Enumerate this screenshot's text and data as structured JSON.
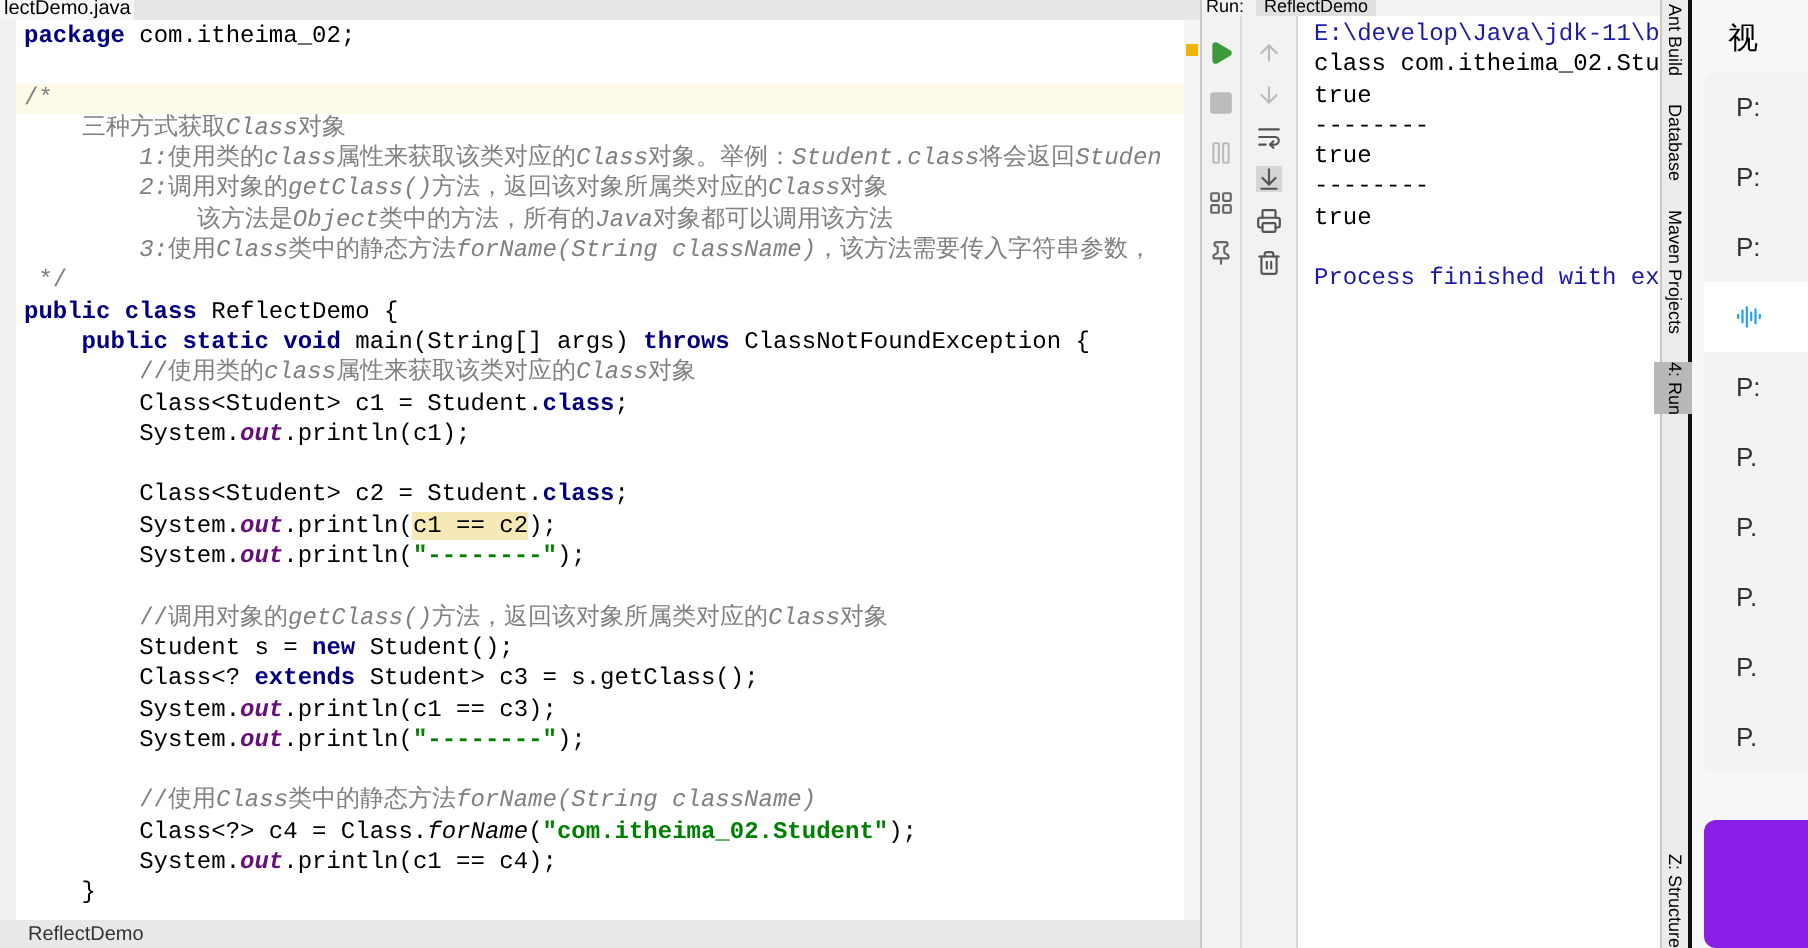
{
  "editor": {
    "tab": "lectDemo.java",
    "lines": [
      {
        "kind": "code",
        "current": false,
        "tokens": [
          {
            "text": "package",
            "kind": "kw"
          },
          {
            "text": " com.itheima_02;",
            "kind": "plain"
          }
        ]
      },
      {
        "kind": "blank"
      },
      {
        "kind": "code",
        "current": true,
        "tokens": [
          {
            "text": "/*",
            "kind": "cm"
          }
        ]
      },
      {
        "kind": "code",
        "current": false,
        "tokens": [
          {
            "text": "    三种方式获取",
            "kind": "cm"
          },
          {
            "text": "Class",
            "kind": "cmi"
          },
          {
            "text": "对象",
            "kind": "cm"
          }
        ]
      },
      {
        "kind": "code",
        "current": false,
        "tokens": [
          {
            "text": "        1:",
            "kind": "cmi"
          },
          {
            "text": "使用类的",
            "kind": "cm"
          },
          {
            "text": "class",
            "kind": "cmi"
          },
          {
            "text": "属性来获取该类对应的",
            "kind": "cm"
          },
          {
            "text": "Class",
            "kind": "cmi"
          },
          {
            "text": "对象。举例：",
            "kind": "cm"
          },
          {
            "text": "Student.class",
            "kind": "cmi"
          },
          {
            "text": "将会返回",
            "kind": "cm"
          },
          {
            "text": "Studen",
            "kind": "cmi"
          }
        ]
      },
      {
        "kind": "code",
        "current": false,
        "tokens": [
          {
            "text": "        2:",
            "kind": "cmi"
          },
          {
            "text": "调用对象的",
            "kind": "cm"
          },
          {
            "text": "getClass()",
            "kind": "cmi"
          },
          {
            "text": "方法，返回该对象所属类对应的",
            "kind": "cm"
          },
          {
            "text": "Class",
            "kind": "cmi"
          },
          {
            "text": "对象",
            "kind": "cm"
          }
        ]
      },
      {
        "kind": "code",
        "current": false,
        "tokens": [
          {
            "text": "            该方法是",
            "kind": "cm"
          },
          {
            "text": "Object",
            "kind": "cmi"
          },
          {
            "text": "类中的方法，所有的",
            "kind": "cm"
          },
          {
            "text": "Java",
            "kind": "cmi"
          },
          {
            "text": "对象都可以调用该方法",
            "kind": "cm"
          }
        ]
      },
      {
        "kind": "code",
        "current": false,
        "tokens": [
          {
            "text": "        3:",
            "kind": "cmi"
          },
          {
            "text": "使用",
            "kind": "cm"
          },
          {
            "text": "Class",
            "kind": "cmi"
          },
          {
            "text": "类中的静态方法",
            "kind": "cm"
          },
          {
            "text": "forName(String className)",
            "kind": "cmi"
          },
          {
            "text": "，该方法需要传入字符串参数，",
            "kind": "cm"
          }
        ]
      },
      {
        "kind": "code",
        "current": false,
        "tokens": [
          {
            "text": " */",
            "kind": "cm"
          }
        ]
      },
      {
        "kind": "code",
        "current": false,
        "tokens": [
          {
            "text": "public class",
            "kind": "kw"
          },
          {
            "text": " ReflectDemo {",
            "kind": "plain"
          }
        ]
      },
      {
        "kind": "code",
        "current": false,
        "tokens": [
          {
            "text": "    public static void",
            "kind": "kw"
          },
          {
            "text": " main(String[] args) ",
            "kind": "plain"
          },
          {
            "text": "throws",
            "kind": "kw"
          },
          {
            "text": " ClassNotFoundException {",
            "kind": "plain"
          }
        ]
      },
      {
        "kind": "code",
        "current": false,
        "tokens": [
          {
            "text": "        //使用类的",
            "kind": "cm"
          },
          {
            "text": "class",
            "kind": "cmi"
          },
          {
            "text": "属性来获取该类对应的",
            "kind": "cm"
          },
          {
            "text": "Class",
            "kind": "cmi"
          },
          {
            "text": "对象",
            "kind": "cm"
          }
        ]
      },
      {
        "kind": "code",
        "current": false,
        "tokens": [
          {
            "text": "        Class<Student> c1 = Student.",
            "kind": "plain"
          },
          {
            "text": "class",
            "kind": "kw"
          },
          {
            "text": ";",
            "kind": "plain"
          }
        ]
      },
      {
        "kind": "code",
        "current": false,
        "tokens": [
          {
            "text": "        System.",
            "kind": "plain"
          },
          {
            "text": "out",
            "kind": "field"
          },
          {
            "text": ".println(c1);",
            "kind": "plain"
          }
        ]
      },
      {
        "kind": "blank"
      },
      {
        "kind": "code",
        "current": false,
        "tokens": [
          {
            "text": "        Class<Student> c2 = Student.",
            "kind": "plain"
          },
          {
            "text": "class",
            "kind": "kw"
          },
          {
            "text": ";",
            "kind": "plain"
          }
        ]
      },
      {
        "kind": "code",
        "current": false,
        "tokens": [
          {
            "text": "        System.",
            "kind": "plain"
          },
          {
            "text": "out",
            "kind": "field"
          },
          {
            "text": ".println(",
            "kind": "plain"
          },
          {
            "text": "c1 == c2",
            "kind": "hl"
          },
          {
            "text": ");",
            "kind": "plain"
          }
        ]
      },
      {
        "kind": "code",
        "current": false,
        "tokens": [
          {
            "text": "        System.",
            "kind": "plain"
          },
          {
            "text": "out",
            "kind": "field"
          },
          {
            "text": ".println(",
            "kind": "plain"
          },
          {
            "text": "\"--------\"",
            "kind": "str"
          },
          {
            "text": ");",
            "kind": "plain"
          }
        ]
      },
      {
        "kind": "blank"
      },
      {
        "kind": "code",
        "current": false,
        "tokens": [
          {
            "text": "        //调用对象的",
            "kind": "cm"
          },
          {
            "text": "getClass()",
            "kind": "cmi"
          },
          {
            "text": "方法，返回该对象所属类对应的",
            "kind": "cm"
          },
          {
            "text": "Class",
            "kind": "cmi"
          },
          {
            "text": "对象",
            "kind": "cm"
          }
        ]
      },
      {
        "kind": "code",
        "current": false,
        "tokens": [
          {
            "text": "        Student s = ",
            "kind": "plain"
          },
          {
            "text": "new",
            "kind": "kw"
          },
          {
            "text": " Student();",
            "kind": "plain"
          }
        ]
      },
      {
        "kind": "code",
        "current": false,
        "tokens": [
          {
            "text": "        Class<? ",
            "kind": "plain"
          },
          {
            "text": "extends",
            "kind": "kw"
          },
          {
            "text": " Student> c3 = s.getClass();",
            "kind": "plain"
          }
        ]
      },
      {
        "kind": "code",
        "current": false,
        "tokens": [
          {
            "text": "        System.",
            "kind": "plain"
          },
          {
            "text": "out",
            "kind": "field"
          },
          {
            "text": ".println(c1 == c3);",
            "kind": "plain"
          }
        ]
      },
      {
        "kind": "code",
        "current": false,
        "tokens": [
          {
            "text": "        System.",
            "kind": "plain"
          },
          {
            "text": "out",
            "kind": "field"
          },
          {
            "text": ".println(",
            "kind": "plain"
          },
          {
            "text": "\"--------\"",
            "kind": "str"
          },
          {
            "text": ");",
            "kind": "plain"
          }
        ]
      },
      {
        "kind": "blank"
      },
      {
        "kind": "code",
        "current": false,
        "tokens": [
          {
            "text": "        //使用",
            "kind": "cm"
          },
          {
            "text": "Class",
            "kind": "cmi"
          },
          {
            "text": "类中的静态方法",
            "kind": "cm"
          },
          {
            "text": "forName(String className)",
            "kind": "cmi"
          }
        ]
      },
      {
        "kind": "code",
        "current": false,
        "tokens": [
          {
            "text": "        Class<?> c4 = Class.",
            "kind": "plain"
          },
          {
            "text": "forName",
            "kind": "static"
          },
          {
            "text": "(",
            "kind": "plain"
          },
          {
            "text": "\"com.itheima_02.Student\"",
            "kind": "str"
          },
          {
            "text": ");",
            "kind": "plain"
          }
        ]
      },
      {
        "kind": "code",
        "current": false,
        "tokens": [
          {
            "text": "        System.",
            "kind": "plain"
          },
          {
            "text": "out",
            "kind": "field"
          },
          {
            "text": ".println(c1 == c4);",
            "kind": "plain"
          }
        ]
      },
      {
        "kind": "code",
        "current": false,
        "tokens": [
          {
            "text": "    }",
            "kind": "plain"
          }
        ]
      }
    ],
    "bottom_tab": "ReflectDemo"
  },
  "run": {
    "label": "Run:",
    "tab": "ReflectDemo",
    "console": [
      {
        "text": "E:\\develop\\Java\\jdk-11\\b",
        "kind": "info"
      },
      {
        "text": "class com.itheima_02.Stu",
        "kind": "out"
      },
      {
        "text": "true",
        "kind": "out"
      },
      {
        "text": "--------",
        "kind": "out"
      },
      {
        "text": "true",
        "kind": "out"
      },
      {
        "text": "--------",
        "kind": "out"
      },
      {
        "text": "true",
        "kind": "out"
      },
      {
        "kind": "blank"
      },
      {
        "text": "Process finished with ex",
        "kind": "info"
      }
    ]
  },
  "tool_strip": [
    {
      "label": "Ant Build",
      "selected": false
    },
    {
      "label": "Database",
      "selected": false
    },
    {
      "label": "Maven Projects",
      "selected": false
    },
    {
      "label": "4: Run",
      "selected": true
    },
    {
      "label": "Z: Structure",
      "selected": false
    }
  ],
  "side_panel": {
    "heading": "视",
    "items": [
      {
        "label": "P:",
        "selected": false
      },
      {
        "label": "P:",
        "selected": false
      },
      {
        "label": "P:",
        "selected": false
      },
      {
        "selected": true
      },
      {
        "label": "P:",
        "selected": false
      },
      {
        "label": "P.",
        "selected": false
      },
      {
        "label": "P.",
        "selected": false
      },
      {
        "label": "P.",
        "selected": false
      },
      {
        "label": "P.",
        "selected": false
      },
      {
        "label": "P.",
        "selected": false
      }
    ]
  }
}
